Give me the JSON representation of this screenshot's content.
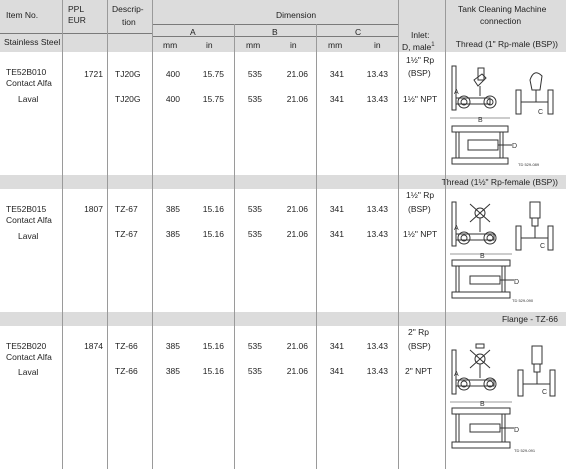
{
  "header": {
    "item_no": "Item No.",
    "ppl": "PPL",
    "eur": "EUR",
    "descrip1": "Descrip-",
    "descrip2": "tion",
    "dimension": "Dimension",
    "tcm1": "Tank Cleaning Machine",
    "tcm2": "connection",
    "a": "A",
    "b": "B",
    "c": "C",
    "mm": "mm",
    "in": "in",
    "stainless": "Stainless Steel",
    "inlet1": "Inlet:",
    "inlet2": "D, male",
    "inlet_sup": "1"
  },
  "sections": [
    {
      "band": "Thread (1\" Rp-male (BSP))",
      "item_lines": [
        "TE52B010",
        "Contact Alfa",
        "Laval"
      ],
      "ppl": "1721",
      "rows": [
        {
          "desc": "TJ20G",
          "a_mm": "400",
          "a_in": "15.75",
          "b_mm": "535",
          "b_in": "21.06",
          "c_mm": "341",
          "c_in": "13.43",
          "inlet1": "1½\" Rp",
          "inlet2": "(BSP)"
        },
        {
          "desc": "TJ20G",
          "a_mm": "400",
          "a_in": "15.75",
          "b_mm": "535",
          "b_in": "21.06",
          "c_mm": "341",
          "c_in": "13.43",
          "inlet1": "1½\" NPT",
          "inlet2": ""
        }
      ],
      "drawing_code": "TD 529-089"
    },
    {
      "band": "Thread (1½\" Rp-female (BSP))",
      "item_lines": [
        "TE52B015",
        "Contact Alfa",
        "Laval"
      ],
      "ppl": "1807",
      "rows": [
        {
          "desc": "TZ-67",
          "a_mm": "385",
          "a_in": "15.16",
          "b_mm": "535",
          "b_in": "21.06",
          "c_mm": "341",
          "c_in": "13.43",
          "inlet1": "1½\" Rp",
          "inlet2": "(BSP)"
        },
        {
          "desc": "TZ-67",
          "a_mm": "385",
          "a_in": "15.16",
          "b_mm": "535",
          "b_in": "21.06",
          "c_mm": "341",
          "c_in": "13.43",
          "inlet1": "1½\" NPT",
          "inlet2": ""
        }
      ],
      "drawing_code": "TD 529-090"
    },
    {
      "band": "Flange - TZ-66",
      "item_lines": [
        "TE52B020",
        "Contact Alfa",
        "Laval"
      ],
      "ppl": "1874",
      "rows": [
        {
          "desc": "TZ-66",
          "a_mm": "385",
          "a_in": "15.16",
          "b_mm": "535",
          "b_in": "21.06",
          "c_mm": "341",
          "c_in": "13.43",
          "inlet1": "2\" Rp",
          "inlet2": "(BSP)"
        },
        {
          "desc": "TZ-66",
          "a_mm": "385",
          "a_in": "15.16",
          "b_mm": "535",
          "b_in": "21.06",
          "c_mm": "341",
          "c_in": "13.43",
          "inlet1": "2\" NPT",
          "inlet2": ""
        }
      ],
      "drawing_code": "TD 529-091"
    }
  ],
  "drawing_labels": {
    "a": "A",
    "b": "B",
    "c": "C",
    "d": "D"
  }
}
